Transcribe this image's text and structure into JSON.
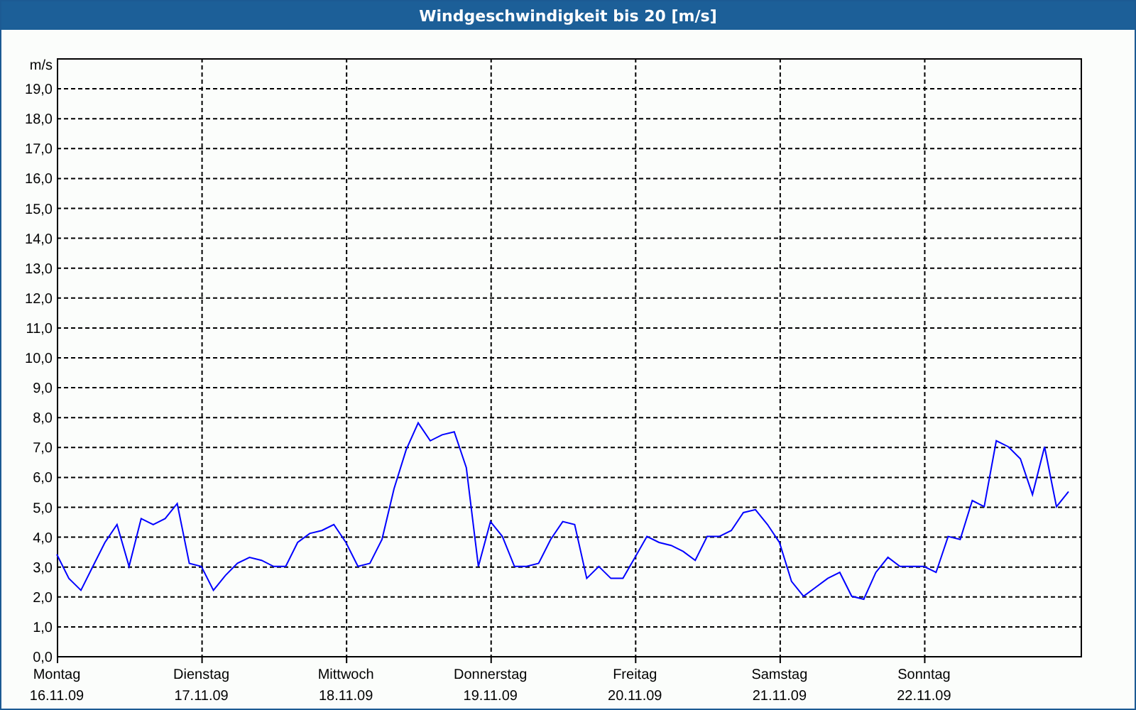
{
  "window": {
    "title": "Windgeschwindigkeit bis 20 [m/s]"
  },
  "chart": {
    "x_axis_dates": [
      "16.11.09",
      "17.11.09",
      "18.11.09",
      "19.11.09",
      "20.11.09",
      "21.11.09",
      "22.11.09"
    ],
    "chart_data": {
      "type": "line",
      "grid": true,
      "ylabel": "m/s",
      "ylim": [
        0,
        20
      ],
      "yticks": [
        {
          "value": 0,
          "label": "0,0"
        },
        {
          "value": 1,
          "label": "1,0"
        },
        {
          "value": 2,
          "label": "2,0"
        },
        {
          "value": 3,
          "label": "3,0"
        },
        {
          "value": 4,
          "label": "4,0"
        },
        {
          "value": 5,
          "label": "5,0"
        },
        {
          "value": 6,
          "label": "6,0"
        },
        {
          "value": 7,
          "label": "7,0"
        },
        {
          "value": 8,
          "label": "8,0"
        },
        {
          "value": 9,
          "label": "9,0"
        },
        {
          "value": 10,
          "label": "10,0"
        },
        {
          "value": 11,
          "label": "11,0"
        },
        {
          "value": 12,
          "label": "12,0"
        },
        {
          "value": 13,
          "label": "13,0"
        },
        {
          "value": 14,
          "label": "14,0"
        },
        {
          "value": 15,
          "label": "15,0"
        },
        {
          "value": 16,
          "label": "16,0"
        },
        {
          "value": 17,
          "label": "17,0"
        },
        {
          "value": 18,
          "label": "18,0"
        },
        {
          "value": 19,
          "label": "19,0"
        }
      ],
      "categories": [
        "Montag",
        null,
        null,
        null,
        null,
        null,
        null,
        null,
        null,
        null,
        null,
        null,
        "Dienstag",
        null,
        null,
        null,
        null,
        null,
        null,
        null,
        null,
        null,
        null,
        null,
        "Mittwoch",
        null,
        null,
        null,
        null,
        null,
        null,
        null,
        null,
        null,
        null,
        null,
        "Donnerstag",
        null,
        null,
        null,
        null,
        null,
        null,
        null,
        null,
        null,
        null,
        null,
        "Freitag",
        null,
        null,
        null,
        null,
        null,
        null,
        null,
        null,
        null,
        null,
        null,
        "Samstag",
        null,
        null,
        null,
        null,
        null,
        null,
        null,
        null,
        null,
        null,
        null,
        "Sonntag",
        null,
        null,
        null,
        null,
        null,
        null,
        null,
        null,
        null,
        null,
        null,
        null
      ],
      "series": [
        {
          "color": "#0000ff",
          "values": [
            3.4,
            2.6,
            2.2,
            3.0,
            3.8,
            4.4,
            3.0,
            4.6,
            4.4,
            4.6,
            5.1,
            3.1,
            3.0,
            2.2,
            2.7,
            3.1,
            3.3,
            3.2,
            3.0,
            3.0,
            3.8,
            4.1,
            4.2,
            4.4,
            3.8,
            3.0,
            3.1,
            3.9,
            5.6,
            6.9,
            7.8,
            7.2,
            7.4,
            7.5,
            6.3,
            3.0,
            4.5,
            4.0,
            3.0,
            3.0,
            3.1,
            3.9,
            4.5,
            4.4,
            2.6,
            3.0,
            2.6,
            2.6,
            3.3,
            4.0,
            3.8,
            3.7,
            3.5,
            3.2,
            4.0,
            4.0,
            4.2,
            4.8,
            4.9,
            4.4,
            3.8,
            2.5,
            2.0,
            2.3,
            2.6,
            2.8,
            2.0,
            1.9,
            2.8,
            3.3,
            3.0,
            3.0,
            3.0,
            2.8,
            4.0,
            3.9,
            5.2,
            5.0,
            7.2,
            7.0,
            6.6,
            5.4,
            7.0,
            5.0,
            5.5
          ]
        }
      ]
    }
  }
}
